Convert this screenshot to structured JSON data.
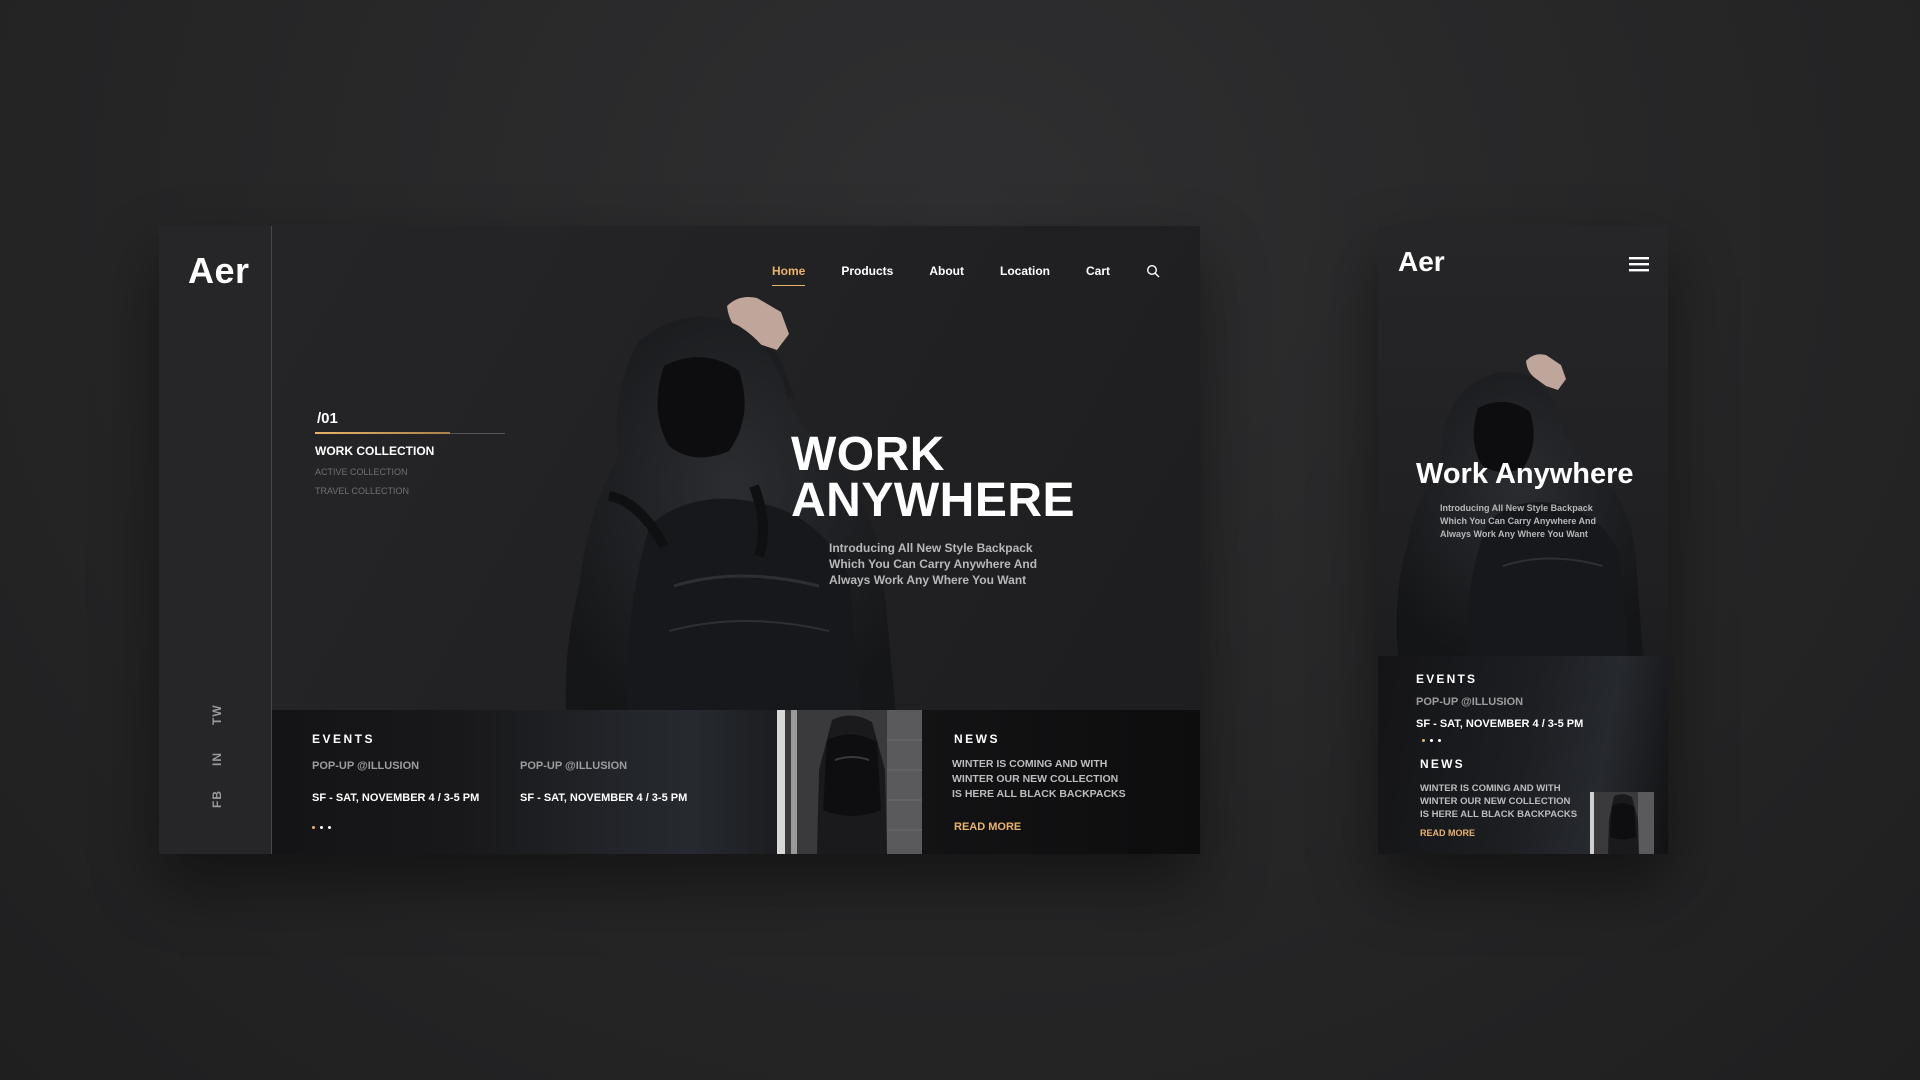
{
  "desktop": {
    "logo": "Aer",
    "nav": {
      "items": [
        {
          "label": "Home",
          "active": true
        },
        {
          "label": "Products",
          "active": false
        },
        {
          "label": "About",
          "active": false
        },
        {
          "label": "Location",
          "active": false
        },
        {
          "label": "Cart",
          "active": false
        }
      ],
      "search_icon": "search-icon"
    },
    "social": [
      "TW",
      "IN",
      "FB"
    ],
    "collections": {
      "index": "/01",
      "active": "WORK COLLECTION",
      "others": [
        "ACTIVE COLLECTION",
        "TRAVEL COLLECTION"
      ]
    },
    "hero": {
      "headline_line1": "WORK",
      "headline_line2": "ANYWHERE",
      "subtitle_line1": "Introducing All New Style Backpack",
      "subtitle_line2": "Which You Can Carry Anywhere And",
      "subtitle_line3": "Always Work Any Where You Want"
    },
    "events": {
      "title": "EVENTS",
      "items": [
        {
          "name": "POP-UP @ILLUSION",
          "date": "SF - SAT, NOVEMBER 4 / 3-5 PM"
        },
        {
          "name": "POP-UP @ILLUSION",
          "date": "SF - SAT, NOVEMBER 4 / 3-5 PM"
        }
      ],
      "dots_total": 3,
      "dots_active": 1
    },
    "news": {
      "title": "NEWS",
      "line1": "WINTER IS COMING AND WITH",
      "line2": "WINTER OUR NEW COLLECTION",
      "line3": "IS HERE ALL BLACK BACKPACKS",
      "read_more": "READ MORE"
    }
  },
  "mobile": {
    "logo": "Aer",
    "menu_icon": "hamburger-menu-icon",
    "hero": {
      "headline": "Work Anywhere",
      "subtitle_line1": "Introducing All New Style Backpack",
      "subtitle_line2": "Which You Can Carry Anywhere And",
      "subtitle_line3": "Always Work Any Where You Want"
    },
    "events": {
      "title": "EVENTS",
      "name": "POP-UP @ILLUSION",
      "date": "SF - SAT, NOVEMBER 4 / 3-5 PM"
    },
    "news": {
      "title": "NEWS",
      "line1": "WINTER IS COMING AND WITH",
      "line2": "WINTER OUR NEW COLLECTION",
      "line3": "IS HERE ALL BLACK BACKPACKS",
      "read_more": "READ MORE"
    }
  },
  "colors": {
    "accent": "#e8b36a",
    "background": "#262627",
    "panel": "#222224"
  }
}
